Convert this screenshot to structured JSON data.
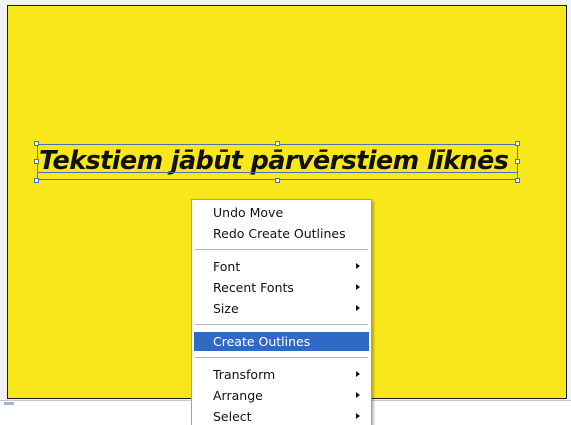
{
  "artboard": {
    "background": "#f8e71a",
    "text": "Tekstiem jābūt pārvērstiem līknēs"
  },
  "selection": {
    "color": "#4d6fb5"
  },
  "context_menu": {
    "items": [
      {
        "label": "Undo Move",
        "submenu": false
      },
      {
        "label": "Redo Create Outlines",
        "submenu": false
      },
      {
        "label": "Font",
        "submenu": true
      },
      {
        "label": "Recent Fonts",
        "submenu": true
      },
      {
        "label": "Size",
        "submenu": true
      },
      {
        "label": "Create Outlines",
        "submenu": false,
        "highlighted": true
      },
      {
        "label": "Transform",
        "submenu": true
      },
      {
        "label": "Arrange",
        "submenu": true
      },
      {
        "label": "Select",
        "submenu": true
      }
    ],
    "highlight_color": "#316ac5"
  }
}
